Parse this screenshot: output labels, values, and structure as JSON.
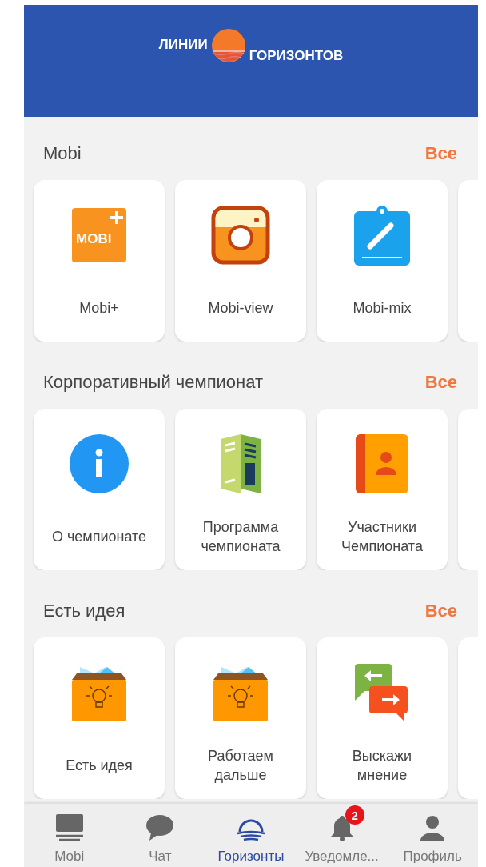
{
  "header": {
    "logo_left": "ЛИНИИ",
    "logo_right": "ГОРИЗОНТОВ"
  },
  "sections": [
    {
      "title": "Mobi",
      "all_link": "Все",
      "items": [
        {
          "kind": "mobi-plus",
          "label": "Mobi+",
          "icon_text": "MOBI"
        },
        {
          "kind": "camera",
          "label": "Mobi-view"
        },
        {
          "kind": "clipboard",
          "label": "Mobi-mix"
        }
      ]
    },
    {
      "title": "Корпоративный чемпионат",
      "all_link": "Все",
      "items": [
        {
          "kind": "info",
          "label": "О чемпионате"
        },
        {
          "kind": "brochure",
          "label": "Программа чемпионата"
        },
        {
          "kind": "contacts",
          "label": "Участники Чемпионата"
        }
      ]
    },
    {
      "title": "Есть идея",
      "all_link": "Все",
      "items": [
        {
          "kind": "idea-box",
          "label": "Есть идея"
        },
        {
          "kind": "idea-box",
          "label": "Работаем дальше"
        },
        {
          "kind": "chat-arrows",
          "label": "Выскажи мнение"
        }
      ]
    }
  ],
  "bottom_nav": [
    {
      "kind": "monitor",
      "label": "Mobi",
      "selected": false
    },
    {
      "kind": "chat",
      "label": "Чат",
      "selected": false
    },
    {
      "kind": "horizon",
      "label": "Горизонты",
      "selected": true
    },
    {
      "kind": "bell",
      "label": "Уведомле...",
      "selected": false,
      "badge": "2"
    },
    {
      "kind": "person",
      "label": "Профиль",
      "selected": false
    }
  ]
}
